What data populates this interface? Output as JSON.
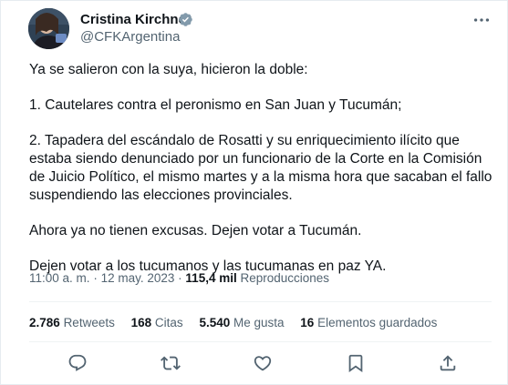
{
  "author": {
    "name": "Cristina Kirchner",
    "handle": "@CFKArgentina",
    "verified_color": "#829aab"
  },
  "tweet": {
    "paragraphs": [
      "Ya se salieron con la suya, hicieron la doble:",
      "1. Cautelares contra el peronismo en San Juan y Tucumán;",
      "2. Tapadera del escándalo de Rosatti y su enriquecimiento ilícito que estaba siendo denunciado por un funcionario de la Corte en la Comisión de Juicio Político, el mismo martes y a la misma hora que sacaban el fallo suspendiendo las elecciones provinciales.",
      "Ahora ya no tienen excusas. Dejen votar a Tucumán.",
      "Dejen votar a los tucumanos y las tucumanas en paz YA."
    ]
  },
  "meta": {
    "time": "11:00 a. m.",
    "separator": "·",
    "date": "12 may. 2023",
    "views_count": "115,4 mil",
    "views_label": "Reproducciones"
  },
  "stats": {
    "retweets_count": "2.786",
    "retweets_label": "Retweets",
    "quotes_count": "168",
    "quotes_label": "Citas",
    "likes_count": "5.540",
    "likes_label": "Me gusta",
    "bookmarks_count": "16",
    "bookmarks_label": "Elementos guardados"
  },
  "actions": {
    "icons": [
      "reply-icon",
      "retweet-icon",
      "like-icon",
      "bookmark-icon",
      "share-icon"
    ],
    "icon_color": "#536471"
  },
  "colors": {
    "text": "#0f1419",
    "secondary": "#536471",
    "divider": "#eff3f4"
  }
}
